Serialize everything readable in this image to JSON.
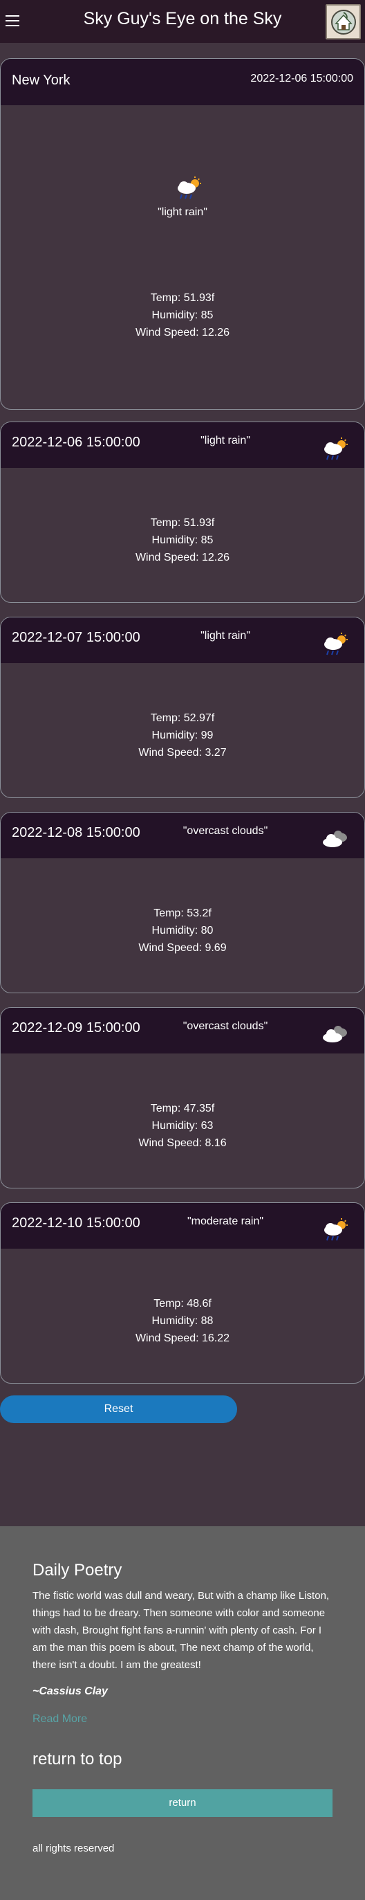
{
  "header": {
    "title": "Sky Guy's Eye on the Sky",
    "menu_icon": "hamburger-menu-icon",
    "logo_icon": "logo-icon"
  },
  "current": {
    "city": "New York",
    "datetime": "2022-12-06 15:00:00",
    "description": "\"light rain\"",
    "icon": "rain-cloud-sun-icon",
    "temp": "Temp: 51.93f",
    "humidity": "Humidity: 85",
    "wind": "Wind Speed: 12.26"
  },
  "forecast": [
    {
      "date": "2022-12-06 15:00:00",
      "description": "\"light rain\"",
      "icon": "rain-cloud-sun-icon",
      "temp": "Temp: 51.93f",
      "humidity": "Humidity: 85",
      "wind": "Wind Speed: 12.26"
    },
    {
      "date": "2022-12-07 15:00:00",
      "description": "\"light rain\"",
      "icon": "rain-cloud-sun-icon",
      "temp": "Temp: 52.97f",
      "humidity": "Humidity: 99",
      "wind": "Wind Speed: 3.27"
    },
    {
      "date": "2022-12-08 15:00:00",
      "description": "\"overcast clouds\"",
      "icon": "overcast-clouds-icon",
      "temp": "Temp: 53.2f",
      "humidity": "Humidity: 80",
      "wind": "Wind Speed: 9.69"
    },
    {
      "date": "2022-12-09 15:00:00",
      "description": "\"overcast clouds\"",
      "icon": "overcast-clouds-icon",
      "temp": "Temp: 47.35f",
      "humidity": "Humidity: 63",
      "wind": "Wind Speed: 8.16"
    },
    {
      "date": "2022-12-10 15:00:00",
      "description": "\"moderate rain\"",
      "icon": "rain-cloud-sun-icon",
      "temp": "Temp: 48.6f",
      "humidity": "Humidity: 88",
      "wind": "Wind Speed: 16.22"
    }
  ],
  "reset_label": "Reset",
  "footer": {
    "poem_title": "Daily Poetry",
    "poem": "The fistic world was dull and weary, But with a champ like Liston, things had to be dreary. Then someone with color and someone with dash, Brought fight fans a-runnin' with plenty of cash. For I am the man this poem is about, The next champ of the world, there isn't a doubt. I am the greatest!",
    "author": "~Cassius Clay",
    "read_more": "Read More",
    "return_title": "return to top",
    "return_label": "return",
    "rights": "all rights reserved"
  },
  "colors": {
    "header_bg": "#2a1827",
    "card_top_bg": "#231227",
    "page_bg": "#423540",
    "reset_button": "#1b79be",
    "footer_bg": "#616161",
    "return_button": "#51a3a2",
    "link": "#58a4a6"
  }
}
